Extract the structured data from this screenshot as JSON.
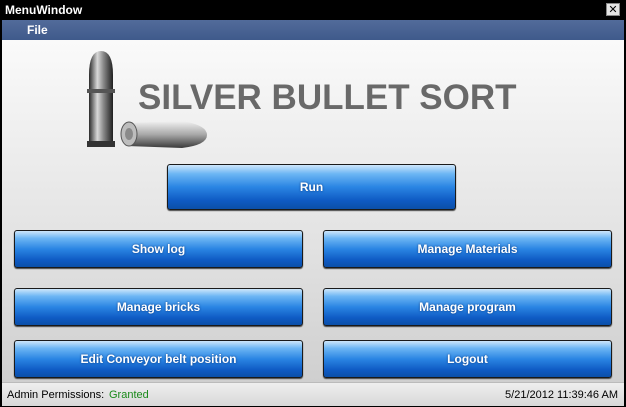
{
  "window": {
    "title": "MenuWindow",
    "close_glyph": "✕"
  },
  "menu": {
    "file_label": "File"
  },
  "logo": {
    "text": "SILVER BULLET SORT",
    "icon": "bullets-icon"
  },
  "buttons": {
    "run": "Run",
    "show_log": "Show log",
    "manage_materials": "Manage Materials",
    "manage_bricks": "Manage bricks",
    "manage_program": "Manage program",
    "edit_conveyor": "Edit Conveyor belt position",
    "logout": "Logout"
  },
  "status": {
    "label": "Admin Permissions:",
    "value": "Granted",
    "datetime": "5/21/2012 11:39:46 AM"
  },
  "colors": {
    "button_blue": "#2a85e3",
    "status_granted": "#1a8a1a",
    "menubar": "#4a6393",
    "logo_text": "#696969"
  }
}
